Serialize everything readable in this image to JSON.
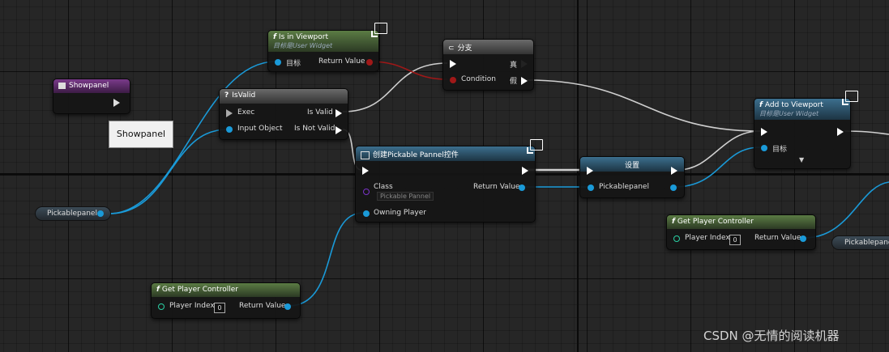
{
  "nodes": {
    "is_in_viewport": {
      "title": "Is in Viewport",
      "subtitle": "目标是User Widget",
      "target": "目标",
      "return": "Return Value"
    },
    "branch": {
      "title": "分支",
      "condition": "Condition",
      "true_label": "真",
      "false_label": "假"
    },
    "showpanel_event": {
      "title": "Showpanel"
    },
    "comment": "Showpanel",
    "isvalid": {
      "title": "IsValid",
      "exec": "Exec",
      "input": "Input Object",
      "is_valid": "Is Valid",
      "is_not_valid": "Is Not Valid"
    },
    "create_widget": {
      "title": "创建Pickable Pannel控件",
      "class": "Class",
      "class_value": "Pickable Pannel",
      "owning": "Owning Player",
      "return": "Return Value"
    },
    "set_node": {
      "title": "设置",
      "var": "Pickablepanel"
    },
    "add_to_viewport": {
      "title": "Add to Viewport",
      "subtitle": "目标是User Widget",
      "target": "目标"
    },
    "get_pc_right": {
      "title": "Get Player Controller",
      "index_label": "Player Index",
      "index": "0",
      "return": "Return Value"
    },
    "get_pc_bottom": {
      "title": "Get Player Controller",
      "index_label": "Player Index",
      "index": "0",
      "return": "Return Value"
    },
    "var_left": "Pickablepanel",
    "var_right": "Pickablepane"
  },
  "watermark": "CSDN @无情的阅读机器",
  "icons": [
    "function-icon",
    "question-icon",
    "branch-icon",
    "event-icon",
    "widget-icon",
    "net-monitor-icon",
    "expand-arrow-icon"
  ],
  "colors": {
    "exec": "#ffffff",
    "object_pin": "#1a9ad8",
    "bool_pin": "#a01818",
    "int_pin": "#2ad1a4",
    "class_pin": "#7a33c8"
  }
}
